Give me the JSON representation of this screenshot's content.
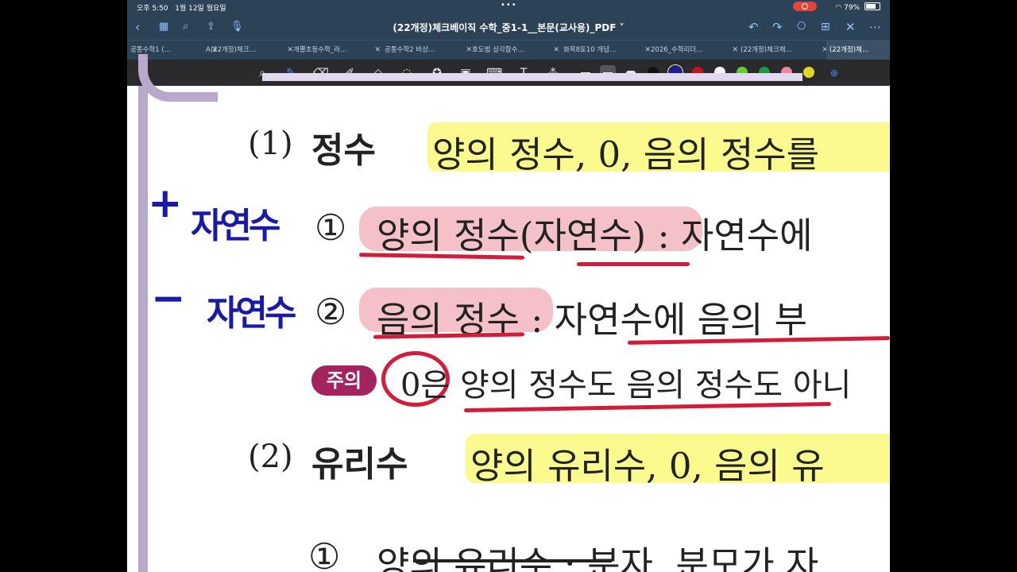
{
  "status": {
    "time": "오후 5:50",
    "date": "1월 12일 월요일",
    "battery": "79%"
  },
  "titlebar": {
    "title": "(22개정)체크베이직 수학_중1-1__본문(교사용)_PDF ˅"
  },
  "tabs": [
    {
      "label": "공통수학1 (…"
    },
    {
      "label": "A(22개정)체크…"
    },
    {
      "label": "개뿔초등수학_라…"
    },
    {
      "label": "공통수학2 비상…"
    },
    {
      "label": "호도법 삼각함수…"
    },
    {
      "label": "화목8토10 개념…"
    },
    {
      "label": "2026_수학리더…"
    },
    {
      "label": "(22개정)체크체…"
    },
    {
      "label": "(22개정)체…"
    }
  ],
  "colors": {
    "accent": "#2c4257",
    "highlight_yellow": "#fafa8e",
    "highlight_pink": "#f3b6be",
    "pen_red": "#d41b3a",
    "pen_blue": "#1a1aa8"
  },
  "swatches": [
    "#111111",
    "#1a1aa8",
    "#cc1122",
    "#ffffff",
    "#66cc33",
    "#1a9944",
    "#ee8899",
    "#ddd922"
  ],
  "content": {
    "l1_num": "(1)",
    "l1_head": "정수",
    "l1_text": "양의 정수, 0, 음의 정수를",
    "a_plus": "+",
    "a_jayeonsu1": "자연수",
    "l2_num": "①",
    "l2_text": "양의 정수(자연수) : 자연수에",
    "a_minus": "−",
    "a_jayeonsu2": "자연수",
    "l3_num": "②",
    "l3_text": "음의 정수 : 자연수에 음의 부",
    "warn_badge": "주의",
    "warn_text": "0은 양의 정수도 음의 정수도 아니",
    "l4_num": "(2)",
    "l4_head": "유리수",
    "l4_text": "양의 유리수, 0, 음의 유",
    "l5_num": "①",
    "l5_text": "양의 유리수 : 분자, 분모가 자"
  }
}
